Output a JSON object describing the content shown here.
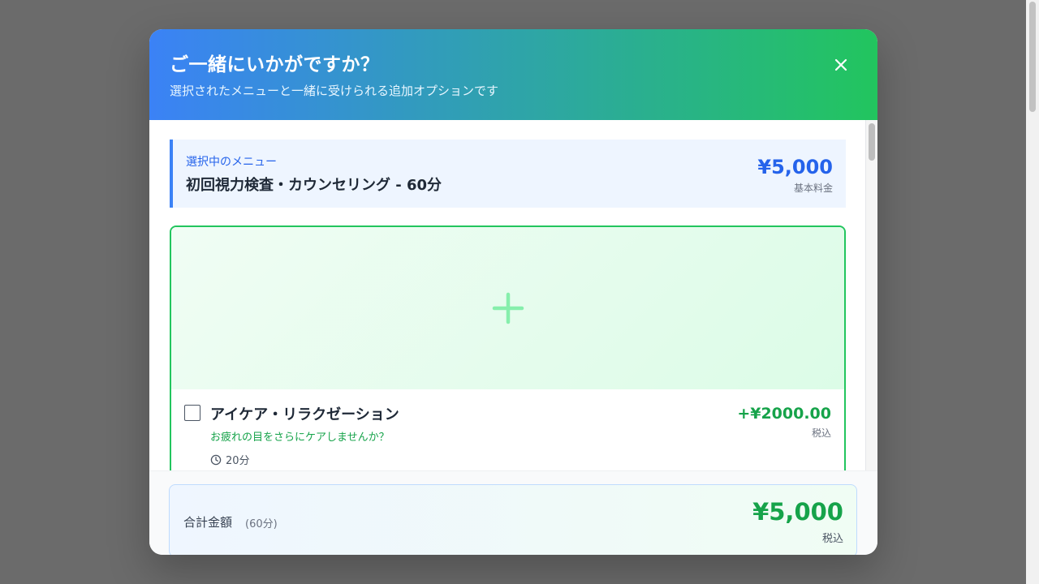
{
  "modal": {
    "title": "ご一緒にいかがですか？",
    "subtitle": "選択されたメニューと一緒に受けられる追加オプションです",
    "close_icon": "close-icon"
  },
  "selected_menu": {
    "label": "選択中のメニュー",
    "name": "初回視力検査・カウンセリング - 60分",
    "price": "¥5,000",
    "price_note": "基本料金"
  },
  "options": [
    {
      "image_icon": "plus-icon",
      "checked": false,
      "name": "アイケア・リラクゼーション",
      "description": "お疲れの目をさらにケアしませんか？",
      "duration": "20分",
      "duration_icon": "clock-icon",
      "price": "+¥2000.00",
      "price_note": "税込"
    }
  ],
  "total": {
    "label": "合計金額",
    "duration": "(60分)",
    "price": "¥5,000",
    "price_note": "税込"
  },
  "colors": {
    "header_gradient_start": "#3b82f6",
    "header_gradient_end": "#22c55e",
    "accent_blue": "#2563eb",
    "accent_green": "#16a34a",
    "overlay": "#6b6b6b"
  }
}
